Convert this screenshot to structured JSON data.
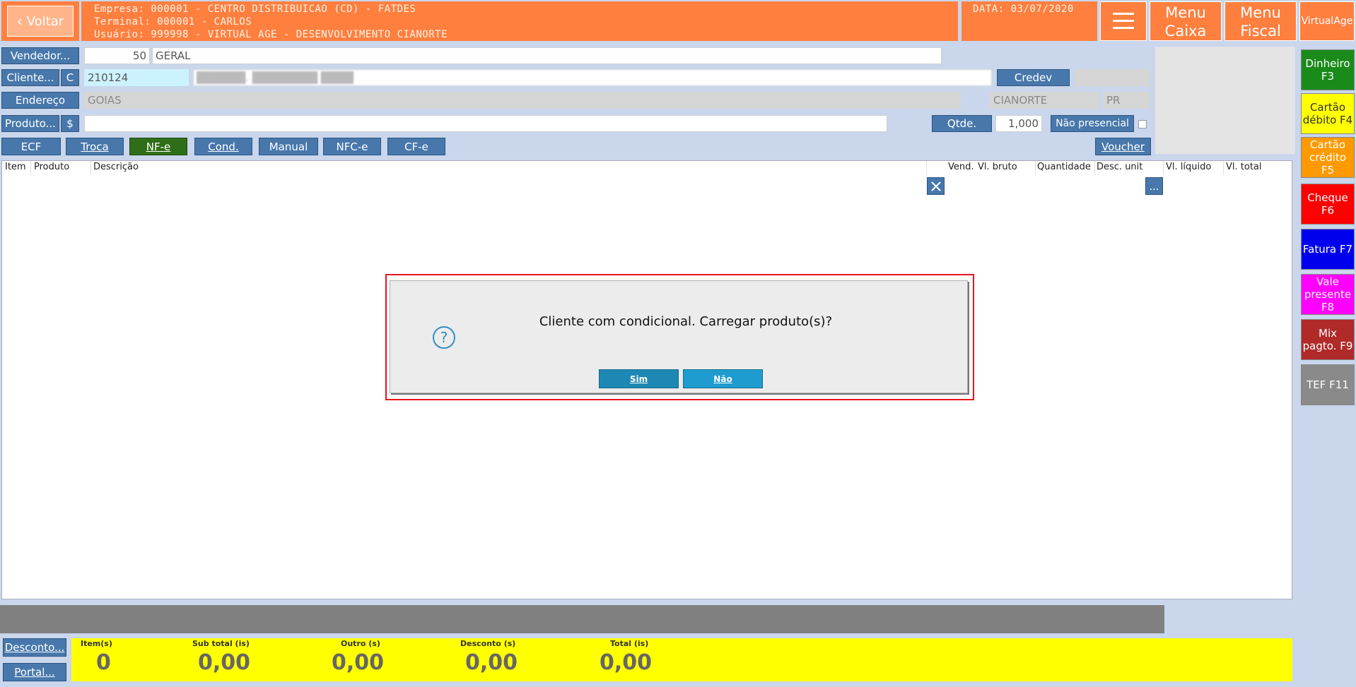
{
  "colors": {
    "header_orange": "#ff7f3f",
    "panel_bg": "#c9d6ec",
    "btn_blue": "#4878ab",
    "nfe_green": "#2f6e18",
    "dialog_border": "#e8141c",
    "totals_yellow": "#ffff00",
    "gray_bar": "#808080"
  },
  "header": {
    "back_label": "Voltar",
    "empresa": "Empresa: 000001 - CENTRO DISTRIBUICAO (CD) - FATDES",
    "terminal": "Terminal: 000001 - CARLOS",
    "usuario": "Usuário: 999998 - VIRTUAL AGE - DESENVOLVIMENTO CIANORTE",
    "data": "DATA: 03/07/2020",
    "menu_icon": "hamburger-icon",
    "menu_caixa": "Menu Caixa",
    "menu_fiscal": "Menu Fiscal",
    "brand": "VirtualAge"
  },
  "form": {
    "vendedor_label": "Vendedor...",
    "vendedor_code": "50",
    "vendedor_name": "GERAL",
    "cliente_label": "Cliente...",
    "cliente_c": "C",
    "cliente_code": "210124",
    "cliente_name": "██████. ████████ ████",
    "credev_label": "Credev",
    "endereco_label": "Endereço",
    "endereco_value": "GOIAS",
    "cidade": "CIANORTE",
    "uf": "PR",
    "produto_label": "Produto...",
    "produto_dollar": "$",
    "qtde_label": "Qtde.",
    "qtde_value": "1,000",
    "nao_presencial_label": "Não presencial"
  },
  "actions": {
    "ecf": "ECF",
    "troca": "Troca",
    "nfe": "NF-e",
    "cond": "Cond.",
    "manual": "Manual",
    "nfce": "NFC-e",
    "cfe": "CF-e",
    "voucher": "Voucher"
  },
  "table": {
    "columns": [
      "Item",
      "Produto",
      "Descrição",
      "Vend.",
      "Vl. bruto",
      "Quantidade",
      "Desc. unit",
      "Vl. líquido",
      "Vl. total"
    ],
    "clear_icon": "close-icon",
    "more_label": "..."
  },
  "payments": [
    {
      "label": "Dinheiro F3",
      "color": "#1a8a1a",
      "text": "#ffffff"
    },
    {
      "label": "Cartão débito F4",
      "color": "#ffff00",
      "text": "#333333"
    },
    {
      "label": "Cartão crédito F5",
      "color": "#ff9900",
      "text": "#ffffff"
    },
    {
      "label": "Cheque F6",
      "color": "#ff0000",
      "text": "#ffffff"
    },
    {
      "label": "Fatura F7",
      "color": "#0000ee",
      "text": "#ffffff"
    },
    {
      "label": "Vale presente F8",
      "color": "#ff00ff",
      "text": "#ffffff"
    },
    {
      "label": "Mix pagto. F9",
      "color": "#b02a2a",
      "text": "#ffffff"
    },
    {
      "label": "TEF F11",
      "color": "#8a8a8a",
      "text": "#ffffff"
    }
  ],
  "dialog": {
    "icon": "question-icon",
    "message": "Cliente com condicional. Carregar produto(s)?",
    "yes": "Sim",
    "no": "Não"
  },
  "footer": {
    "desconto_label": "Desconto...",
    "portal_label": "Portal...",
    "itens_label": "Item(s)",
    "itens_value": "0",
    "subtotal_label": "Sub total (is)",
    "subtotal_value": "0,00",
    "outro_label": "Outro (s)",
    "outro_value": "0,00",
    "desconto_total_label": "Desconto (s)",
    "desconto_total_value": "0,00",
    "total_label": "Total (is)",
    "total_value": "0,00"
  }
}
